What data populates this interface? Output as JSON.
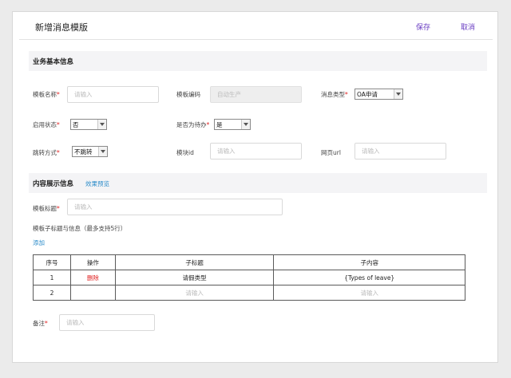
{
  "header": {
    "title": "新增消息模版",
    "save_label": "保存",
    "cancel_label": "取消"
  },
  "section_basic": {
    "title": "业务基本信息"
  },
  "form_basic": {
    "template_name": {
      "label": "模板名称",
      "required_mark": "*",
      "placeholder": "请输入"
    },
    "template_code": {
      "label": "模板编码",
      "placeholder": "自动生产"
    },
    "message_type": {
      "label": "消息类型",
      "required_mark": "*",
      "value": "OA申请"
    },
    "enabled": {
      "label": "启用状态",
      "required_mark": "*",
      "value": "否"
    },
    "is_todo": {
      "label": "是否为待办",
      "required_mark": "*",
      "value": "是"
    },
    "jump_mode": {
      "label": "跳转方式",
      "required_mark": "*",
      "value": "不跳转"
    },
    "module_id": {
      "label": "模块id",
      "placeholder": "请输入"
    },
    "web_url": {
      "label": "网页url",
      "placeholder": "请输入"
    }
  },
  "section_content": {
    "title": "内容展示信息",
    "preview_label": "效果预览"
  },
  "form_content": {
    "template_title": {
      "label": "模板标题",
      "required_mark": "*",
      "placeholder": "请输入"
    },
    "subtitle_heading": "模板子标题与信息（最多支持5行）",
    "add_label": "添加"
  },
  "sub_table": {
    "columns": [
      "序号",
      "操作",
      "子标题",
      "子内容"
    ],
    "rows": [
      {
        "index": "1",
        "action": "删除",
        "subtitle": "请假类型",
        "content": "{Types of leave}"
      },
      {
        "index": "2",
        "action": "",
        "subtitle": "请输入",
        "content": "请输入"
      }
    ]
  },
  "remark": {
    "label": "备注",
    "required_mark": "*",
    "placeholder": "请输入"
  }
}
